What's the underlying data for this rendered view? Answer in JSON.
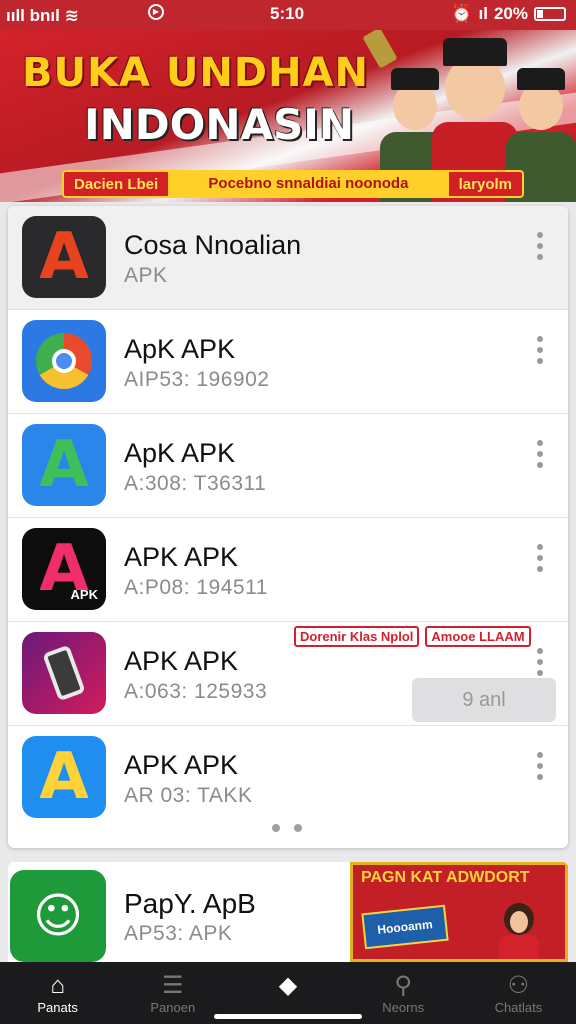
{
  "status_bar": {
    "signal": "ııll",
    "carrier": "bnıl",
    "time": "5:10",
    "battery_pct": "20%",
    "alarm": "⏰",
    "signal2": "ıl"
  },
  "banner": {
    "line1": "BUKA UNDHAN",
    "line2": "INDONASIN",
    "ribbon_left": "Dacien Lbei",
    "ribbon_mid": "Pocebno snnaldiai noonoda",
    "ribbon_right": "laryolm"
  },
  "apps": [
    {
      "title": "Cosa Nnoalian",
      "subtitle": "APK",
      "icon": "a-logo-icon",
      "icon_bg": "#2a2a2c",
      "icon_fg": "#e8431f",
      "badge": ""
    },
    {
      "title": "ApK APK",
      "subtitle": "AIP53: 196902",
      "icon": "chrome-icon",
      "icon_bg": "#2d79e3",
      "icon_fg": "#e74a2c",
      "badge": ""
    },
    {
      "title": "ApK APK",
      "subtitle": "A:308: T36311",
      "icon": "a-green-icon",
      "icon_bg": "#2a86e8",
      "icon_fg": "#3fbf5a",
      "badge": ""
    },
    {
      "title": "APK APK",
      "subtitle": "A:P08: 194511",
      "icon": "a-apk-icon",
      "icon_bg": "#0d0d0d",
      "icon_fg": "#ef2e6b",
      "badge": "APK"
    },
    {
      "title": "APK APK",
      "subtitle": "A:063: 125933",
      "icon": "phone-icon",
      "icon_bg": "#b3177f",
      "icon_fg": "#e8e8e8",
      "badge": ""
    },
    {
      "title": "APK APK",
      "subtitle": "AR 03: TAKK",
      "icon": "a-yellow-icon",
      "icon_bg": "#1f8ef0",
      "icon_fg": "#ffd23a",
      "badge": ""
    }
  ],
  "tags": [
    "Dorenir Klas Nplol",
    "Amooe LLAAM"
  ],
  "ghost_button": "9 anl",
  "promo_app": {
    "title": "PapY. ApB",
    "subtitle": "AP53: APK"
  },
  "promo_banner": {
    "title": "PAGN KAT ADWDORT",
    "box": "Hoooanm"
  },
  "nav": [
    {
      "label": "Panats",
      "icon": "home-icon",
      "glyph": "⌂",
      "active": true
    },
    {
      "label": "Panoen",
      "icon": "list-icon",
      "glyph": "☰",
      "active": false
    },
    {
      "label": "",
      "icon": "apps-icon",
      "glyph": "◆",
      "active": true
    },
    {
      "label": "Neorns",
      "icon": "search-icon",
      "glyph": "⚲",
      "active": false
    },
    {
      "label": "Chatlats",
      "icon": "profile-icon",
      "glyph": "⚇",
      "active": false
    }
  ],
  "colors": {
    "brand_red": "#c0262e",
    "gold": "#ffcd1a"
  }
}
